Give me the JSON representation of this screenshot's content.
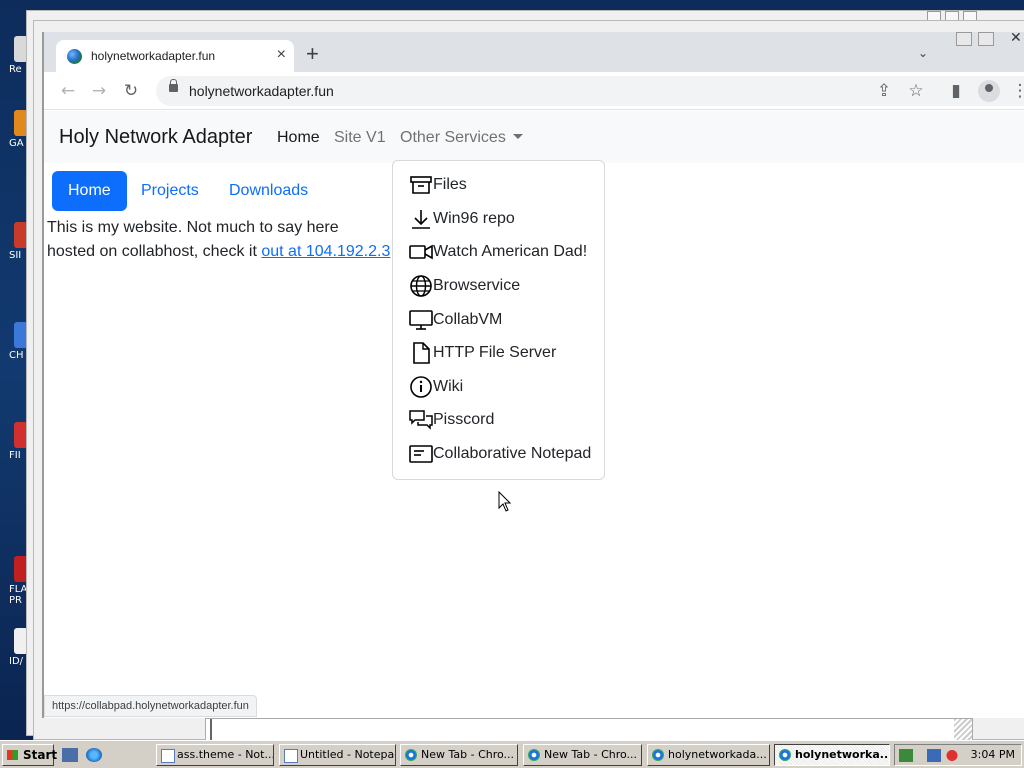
{
  "desktop": {
    "icons": [
      {
        "label": "Re",
        "color": "#d9d9d9"
      },
      {
        "label": "GA",
        "color": "#e08a1e"
      },
      {
        "label": "SII",
        "color": "#c83a2a"
      },
      {
        "label": "CH",
        "color": "#3c78d8"
      },
      {
        "label": "FII",
        "color": "#d03030"
      },
      {
        "label": "FLA PR",
        "color": "#c02020"
      },
      {
        "label": "ID/",
        "color": "#f0f0f0"
      }
    ]
  },
  "browser": {
    "tab_title": "holynetworkadapter.fun",
    "tab_close": "×",
    "new_tab": "+",
    "tab_search": "⌄",
    "url": "holynetworkadapter.fun",
    "back": "←",
    "forward": "→",
    "reload": "↻",
    "share": "⇪",
    "star": "☆",
    "side_panel": "▮",
    "menu": "⋮",
    "window_close": "✕",
    "status_url": "https://collabpad.holynetworkadapter.fun"
  },
  "page": {
    "brand": "Holy Network Adapter",
    "nav": {
      "home": "Home",
      "site_v1": "Site V1",
      "other": "Other Services"
    },
    "pills": {
      "home": "Home",
      "projects": "Projects",
      "downloads": "Downloads"
    },
    "text_line1": "This is my website. Not much to say here",
    "text_line2_prefix": "hosted on collabhost, check it ",
    "text_line2_link": "out at 104.192.2.3",
    "dropdown": [
      {
        "label": "Files",
        "icon": "archive-icon"
      },
      {
        "label": "Win96 repo",
        "icon": "download-icon"
      },
      {
        "label": "Watch American Dad!",
        "icon": "camera-video-icon"
      },
      {
        "label": "Browservice",
        "icon": "globe-icon"
      },
      {
        "label": "CollabVM",
        "icon": "monitor-icon"
      },
      {
        "label": "HTTP File Server",
        "icon": "file-icon"
      },
      {
        "label": "Wiki",
        "icon": "info-icon"
      },
      {
        "label": "Pisscord",
        "icon": "chat-icon"
      },
      {
        "label": "Collaborative Notepad",
        "icon": "notepad-icon"
      }
    ]
  },
  "taskbar": {
    "start": "Start",
    "buttons": [
      {
        "label": "ass.theme - Not...",
        "kind": "np",
        "active": false
      },
      {
        "label": "Untitled - Notepad",
        "kind": "np",
        "active": false
      },
      {
        "label": "New Tab - Chro...",
        "kind": "ch",
        "active": false
      },
      {
        "label": "New Tab - Chro...",
        "kind": "ch",
        "active": false
      },
      {
        "label": "holynetworkada...",
        "kind": "ch",
        "active": false
      },
      {
        "label": "holynetworka...",
        "kind": "ch",
        "active": true
      }
    ],
    "clock": "3:04 PM"
  }
}
